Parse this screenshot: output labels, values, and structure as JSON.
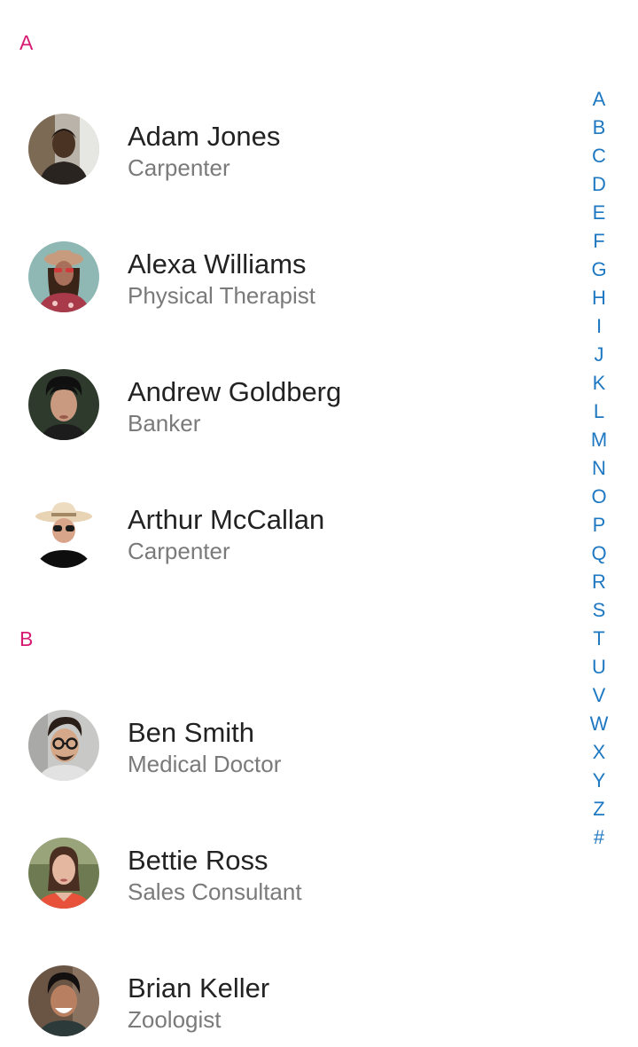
{
  "sections": [
    {
      "letter": "A",
      "contacts": [
        {
          "name": "Adam Jones",
          "title": "Carpenter"
        },
        {
          "name": "Alexa Williams",
          "title": "Physical Therapist"
        },
        {
          "name": "Andrew Goldberg",
          "title": "Banker"
        },
        {
          "name": "Arthur McCallan",
          "title": "Carpenter"
        }
      ]
    },
    {
      "letter": "B",
      "contacts": [
        {
          "name": "Ben Smith",
          "title": "Medical Doctor"
        },
        {
          "name": "Bettie Ross",
          "title": "Sales Consultant"
        },
        {
          "name": "Brian Keller",
          "title": "Zoologist"
        }
      ]
    }
  ],
  "index_letters": [
    "A",
    "B",
    "C",
    "D",
    "E",
    "F",
    "G",
    "H",
    "I",
    "J",
    "K",
    "L",
    "M",
    "N",
    "O",
    "P",
    "Q",
    "R",
    "S",
    "T",
    "U",
    "V",
    "W",
    "X",
    "Y",
    "Z",
    "#"
  ],
  "colors": {
    "section_header": "#d81b72",
    "index_letter": "#1e78c2",
    "name_text": "#222222",
    "title_text": "#7a7a7a"
  }
}
